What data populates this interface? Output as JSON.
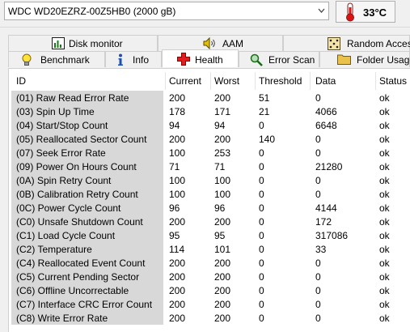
{
  "drive": {
    "name": "WDC WD20EZRZ-00Z5HB0 (2000 gB)",
    "temperature": "33°C"
  },
  "tabs_row1": [
    {
      "label": "Disk monitor",
      "icon": "bar-chart-icon"
    },
    {
      "label": "AAM",
      "icon": "speaker-icon"
    },
    {
      "label": "Random Access",
      "icon": "dice-icon"
    }
  ],
  "tabs_row2": [
    {
      "label": "Benchmark",
      "icon": "lightbulb-icon"
    },
    {
      "label": "Info",
      "icon": "info-icon"
    },
    {
      "label": "Health",
      "icon": "health-cross-icon",
      "active": true
    },
    {
      "label": "Error Scan",
      "icon": "magnifier-icon"
    },
    {
      "label": "Folder Usage",
      "icon": "folder-icon"
    }
  ],
  "columns": [
    "ID",
    "Current",
    "Worst",
    "Threshold",
    "Data",
    "Status"
  ],
  "rows": [
    [
      "(01) Raw Read Error Rate",
      "200",
      "200",
      "51",
      "0",
      "ok"
    ],
    [
      "(03) Spin Up Time",
      "178",
      "171",
      "21",
      "4066",
      "ok"
    ],
    [
      "(04) Start/Stop Count",
      "94",
      "94",
      "0",
      "6648",
      "ok"
    ],
    [
      "(05) Reallocated Sector Count",
      "200",
      "200",
      "140",
      "0",
      "ok"
    ],
    [
      "(07) Seek Error Rate",
      "100",
      "253",
      "0",
      "0",
      "ok"
    ],
    [
      "(09) Power On Hours Count",
      "71",
      "71",
      "0",
      "21280",
      "ok"
    ],
    [
      "(0A) Spin Retry Count",
      "100",
      "100",
      "0",
      "0",
      "ok"
    ],
    [
      "(0B) Calibration Retry Count",
      "100",
      "100",
      "0",
      "0",
      "ok"
    ],
    [
      "(0C) Power Cycle Count",
      "96",
      "96",
      "0",
      "4144",
      "ok"
    ],
    [
      "(C0) Unsafe Shutdown Count",
      "200",
      "200",
      "0",
      "172",
      "ok"
    ],
    [
      "(C1) Load Cycle Count",
      "95",
      "95",
      "0",
      "317086",
      "ok"
    ],
    [
      "(C2) Temperature",
      "114",
      "101",
      "0",
      "33",
      "ok"
    ],
    [
      "(C4) Reallocated Event Count",
      "200",
      "200",
      "0",
      "0",
      "ok"
    ],
    [
      "(C5) Current Pending Sector",
      "200",
      "200",
      "0",
      "0",
      "ok"
    ],
    [
      "(C6) Offline Uncorrectable",
      "200",
      "200",
      "0",
      "0",
      "ok"
    ],
    [
      "(C7) Interface CRC Error Count",
      "200",
      "200",
      "0",
      "0",
      "ok"
    ],
    [
      "(C8) Write Error Rate",
      "200",
      "200",
      "0",
      "0",
      "ok"
    ]
  ]
}
